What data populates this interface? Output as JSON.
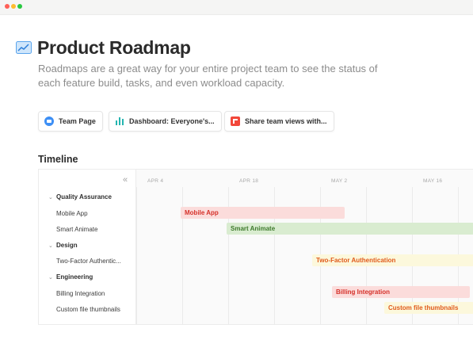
{
  "page": {
    "title": "Product Roadmap",
    "description": "Roadmaps are a great way for your entire project team to see the status of each feature build, tasks, and even workload capacity."
  },
  "links": [
    {
      "label": "Team Page",
      "icon": "team-page-icon"
    },
    {
      "label": "Dashboard: Everyone's...",
      "icon": "dashboard-icon"
    },
    {
      "label": "Share team views with...",
      "icon": "share-icon"
    }
  ],
  "timeline": {
    "title": "Timeline",
    "collapse_glyph": "«",
    "dates": [
      "APR 4",
      "APR 18",
      "MAY 2",
      "MAY 16"
    ],
    "groups": [
      {
        "name": "Quality Assurance",
        "items": [
          "Mobile App",
          "Smart Animate"
        ]
      },
      {
        "name": "Design",
        "items": [
          "Two-Factor Authentic..."
        ]
      },
      {
        "name": "Engineering",
        "items": [
          "Billing Integration",
          "Custom file thumbnails"
        ]
      }
    ],
    "bars": [
      {
        "label": "Mobile App",
        "color": "#fbdcdb"
      },
      {
        "label": "Smart Animate",
        "color": "#d9ecd0"
      },
      {
        "label": "Two-Factor Authentication",
        "color": "#fcf8dc"
      },
      {
        "label": "Billing Integration",
        "color": "#fbdcdb"
      },
      {
        "label": "Custom file thumbnails",
        "color": "#fcf8dc"
      }
    ]
  }
}
